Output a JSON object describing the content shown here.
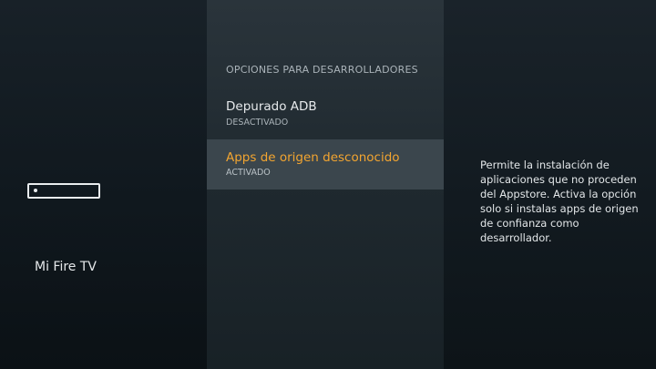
{
  "device": {
    "name": "Mi Fire TV",
    "icon": "fire-tv-stick-icon"
  },
  "settings": {
    "section_title": "OPCIONES PARA DESARROLLADORES",
    "items": [
      {
        "label": "Depurado ADB",
        "status": "DESACTIVADO"
      },
      {
        "label": "Apps de origen desconocido",
        "status": "ACTIVADO",
        "selected": true
      }
    ]
  },
  "description": {
    "text": "Permite la instalación de\naplicaciones que no proceden\ndel Appstore. Activa la opción\nsolo si instalas apps de origen\nde confianza como\ndesarrollador."
  },
  "colors": {
    "accent": "#f3a530",
    "selected_row": "#3b464d"
  }
}
